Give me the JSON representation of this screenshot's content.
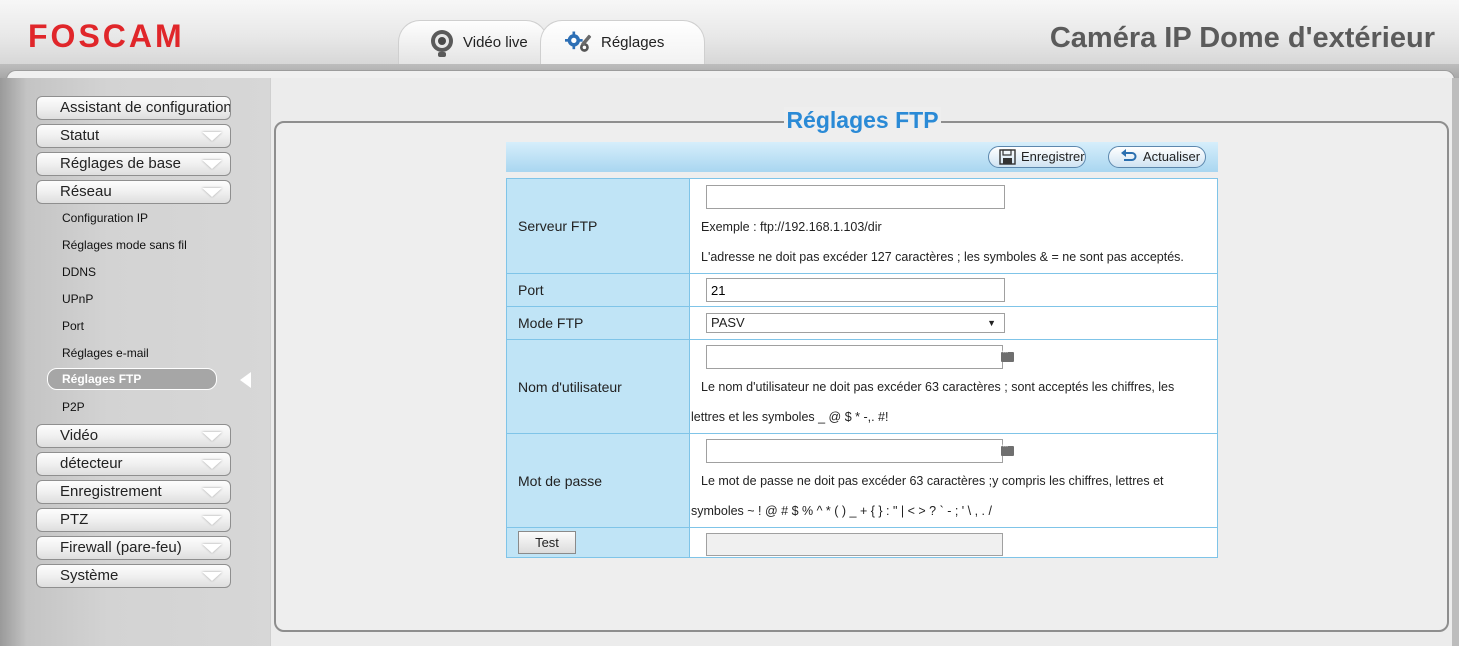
{
  "header": {
    "logo": "FOSCAM",
    "product_title": "Caméra IP Dome d'extérieur",
    "tabs": [
      {
        "label": "Vidéo live",
        "icon": "webcam-icon"
      },
      {
        "label": "Réglages",
        "icon": "gears-wrench-icon"
      }
    ]
  },
  "sidebar": {
    "menu": [
      {
        "label": "Assistant de configuration"
      },
      {
        "label": "Statut"
      },
      {
        "label": "Réglages de base"
      },
      {
        "label": "Réseau"
      },
      {
        "label": "Vidéo"
      },
      {
        "label": "détecteur"
      },
      {
        "label": "Enregistrement"
      },
      {
        "label": "PTZ"
      },
      {
        "label": "Firewall (pare-feu)"
      },
      {
        "label": "Système"
      }
    ],
    "network_submenu": [
      "Configuration IP",
      "Réglages mode sans fil",
      "DDNS",
      "UPnP",
      "Port",
      "Réglages e-mail",
      "Réglages FTP",
      "P2P"
    ],
    "active_item": "Réglages FTP"
  },
  "panel": {
    "title": "Réglages FTP",
    "toolbar": {
      "save_label": "Enregistrer",
      "refresh_label": "Actualiser"
    },
    "form": {
      "server": {
        "label": "Serveur FTP",
        "value": "",
        "example": "Exemple : ftp://192.168.1.103/dir",
        "hint": "L'adresse ne doit pas excéder 127 caractères ; les symboles & = ne sont pas acceptés."
      },
      "port": {
        "label": "Port",
        "value": "21"
      },
      "mode": {
        "label": "Mode FTP",
        "value": "PASV"
      },
      "username": {
        "label": "Nom d'utilisateur",
        "value": "",
        "hint_line1": "Le nom d'utilisateur ne doit pas excéder 63 caractères ; sont acceptés les chiffres, les",
        "hint_line2": "lettres et les symboles _ @ $ * -,. #!"
      },
      "password": {
        "label": "Mot de passe",
        "value": "",
        "hint_line1": "Le mot de passe ne doit pas excéder 63 caractères ;y compris les chiffres, lettres et",
        "hint_line2": "symboles ~ ! @ # $ % ^ * ( ) _ + { } : \" | < > ? ` - ; ' \\ , . /"
      },
      "test": {
        "label": "Test",
        "result": ""
      }
    }
  },
  "colors": {
    "logo_red": "#e0262a",
    "title_blue": "#2a8ad6",
    "label_cell": "#c0e4f6",
    "table_border": "#7fc4e8"
  }
}
